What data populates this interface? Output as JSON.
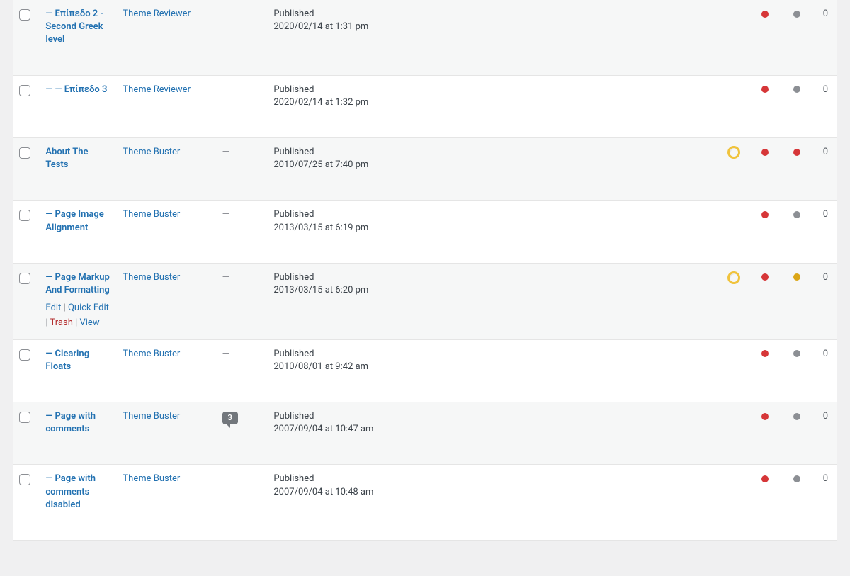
{
  "dash": "—",
  "status_label": "Published",
  "row_actions": {
    "edit": "Edit",
    "quick_edit": "Quick Edit",
    "trash": "Trash",
    "view": "View"
  },
  "rows": [
    {
      "title": "— Επίπεδο 2 - Second Greek level",
      "author": "Theme Reviewer",
      "date": "2020/02/14 at 1:31 pm",
      "alt": true,
      "comments": null,
      "circle": false,
      "dot1": "red",
      "dot2": "gray",
      "count": "0",
      "show_actions": false
    },
    {
      "title": "— — Επίπεδο 3",
      "author": "Theme Reviewer",
      "date": "2020/02/14 at 1:32 pm",
      "alt": false,
      "comments": null,
      "circle": false,
      "dot1": "red",
      "dot2": "gray",
      "count": "0",
      "show_actions": false
    },
    {
      "title": "About The Tests",
      "author": "Theme Buster",
      "date": "2010/07/25 at 7:40 pm",
      "alt": true,
      "comments": null,
      "circle": true,
      "dot1": "red",
      "dot2": "red",
      "count": "0",
      "show_actions": false
    },
    {
      "title": "— Page Image Alignment",
      "author": "Theme Buster",
      "date": "2013/03/15 at 6:19 pm",
      "alt": false,
      "comments": null,
      "circle": false,
      "dot1": "red",
      "dot2": "gray",
      "count": "0",
      "show_actions": false
    },
    {
      "title": "— Page Markup And Formatting",
      "author": "Theme Buster",
      "date": "2013/03/15 at 6:20 pm",
      "alt": true,
      "comments": null,
      "circle": true,
      "dot1": "red",
      "dot2": "orange",
      "count": "0",
      "show_actions": true
    },
    {
      "title": "— Clearing Floats",
      "author": "Theme Buster",
      "date": "2010/08/01 at 9:42 am",
      "alt": false,
      "comments": null,
      "circle": false,
      "dot1": "red",
      "dot2": "gray",
      "count": "0",
      "show_actions": false
    },
    {
      "title": "— Page with comments",
      "author": "Theme Buster",
      "date": "2007/09/04 at 10:47 am",
      "alt": true,
      "comments": "3",
      "circle": false,
      "dot1": "red",
      "dot2": "gray",
      "count": "0",
      "show_actions": false
    },
    {
      "title": "— Page with comments disabled",
      "author": "Theme Buster",
      "date": "2007/09/04 at 10:48 am",
      "alt": false,
      "comments": null,
      "circle": false,
      "dot1": "red",
      "dot2": "gray",
      "count": "0",
      "show_actions": false
    }
  ]
}
